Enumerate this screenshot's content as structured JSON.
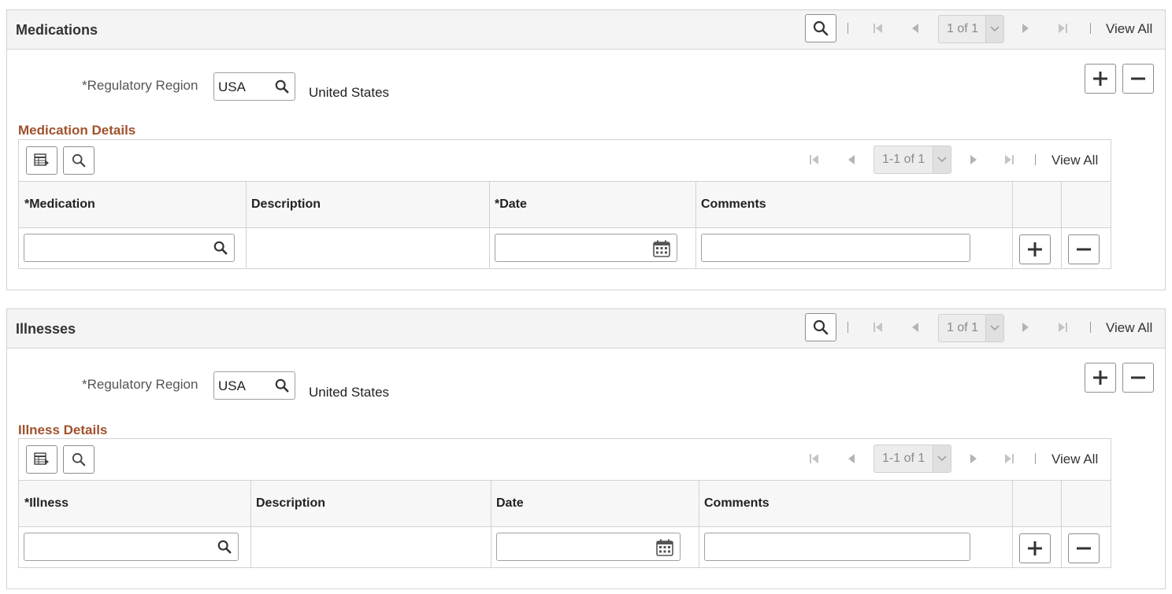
{
  "medications": {
    "title": "Medications",
    "pager": "1 of 1",
    "view_all": "View All",
    "regulatory_region_label": "*Regulatory Region",
    "regulatory_region_value": "USA",
    "regulatory_region_desc": "United States",
    "details_title": "Medication Details",
    "grid_pager": "1-1 of 1",
    "grid_view_all": "View All",
    "columns": [
      "*Medication",
      "Description",
      "*Date",
      "Comments"
    ]
  },
  "illnesses": {
    "title": "Illnesses",
    "pager": "1 of 1",
    "view_all": "View All",
    "regulatory_region_label": "*Regulatory Region",
    "regulatory_region_value": "USA",
    "regulatory_region_desc": "United States",
    "details_title": "Illness Details",
    "grid_pager": "1-1 of 1",
    "grid_view_all": "View All",
    "columns": [
      "*Illness",
      "Description",
      "Date",
      "Comments"
    ]
  },
  "icons": {
    "search": "search-icon",
    "first": "first-page-icon",
    "prev": "previous-page-icon",
    "next": "next-page-icon",
    "last": "last-page-icon",
    "dropdown": "chevron-down-icon",
    "add": "plus-icon",
    "remove": "minus-icon",
    "calendar": "calendar-icon",
    "personalize": "grid-personalize-icon"
  },
  "colors": {
    "details_title": "#a0522d",
    "header_bg": "#f4f4f4"
  }
}
